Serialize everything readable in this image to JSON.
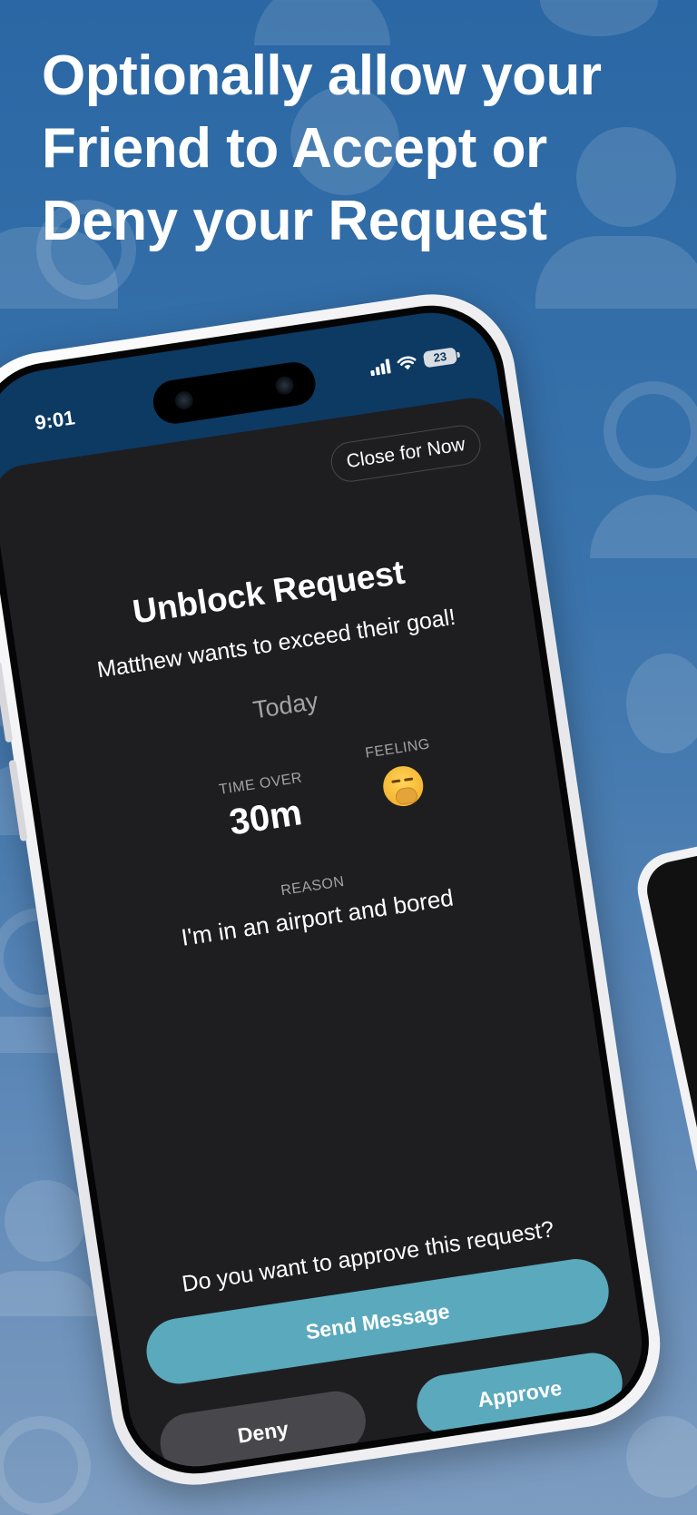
{
  "headline": "Optionally allow your Friend to Accept or Deny your Request",
  "status_bar": {
    "time": "9:01",
    "battery": "23"
  },
  "sheet": {
    "close_label": "Close for Now",
    "title": "Unblock Request",
    "subtitle": "Matthew wants to exceed their goal!",
    "date": "Today",
    "time_over_label": "TIME OVER",
    "time_over_value": "30m",
    "feeling_label": "FEELING",
    "feeling_icon": "yawning-face-emoji",
    "reason_label": "REASON",
    "reason_text": "I'm in an airport and bored",
    "question": "Do you want to approve this request?",
    "send_label": "Send Message",
    "deny_label": "Deny",
    "approve_label": "Approve"
  },
  "colors": {
    "background": "#2a67a4",
    "sheet": "#1e1e20",
    "accent_button": "#5aa9bc",
    "secondary_button": "#48484c"
  }
}
